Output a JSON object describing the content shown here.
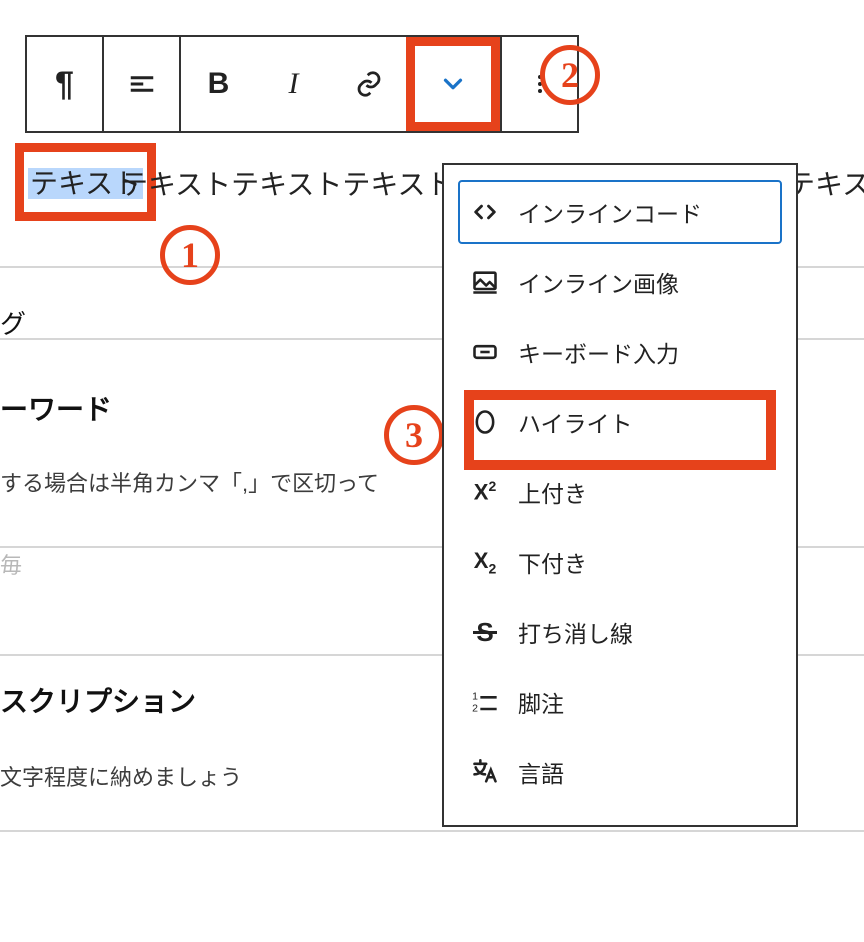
{
  "colors": {
    "accent": "#e6421b",
    "select_bg": "#b9d7fc",
    "focus": "#1a73c8"
  },
  "callouts": {
    "one": "1",
    "two": "2",
    "three": "3"
  },
  "toolbar": {
    "paragraph_icon": "¶",
    "bold_label": "B",
    "italic_label": "I"
  },
  "editor": {
    "selected_text": "テキスト",
    "paragraph_rest": "テキストテキストテキストテキストテキストテキストテキス"
  },
  "dropdown": {
    "items": [
      {
        "label": "インラインコード"
      },
      {
        "label": "インライン画像"
      },
      {
        "label": "キーボード入力"
      },
      {
        "label": "ハイライト"
      },
      {
        "label": "上付き"
      },
      {
        "label": "下付き"
      },
      {
        "label": "打ち消し線"
      },
      {
        "label": "脚注"
      },
      {
        "label": "言語"
      }
    ]
  },
  "form": {
    "row1_label": "グ",
    "row2_label": "ーワード",
    "row2_help": "する場合は半角カンマ「,」で区切って",
    "row3_placeholder": "毎",
    "row4_label": "スクリプション",
    "row4_help": "文字程度に納めましょう"
  }
}
